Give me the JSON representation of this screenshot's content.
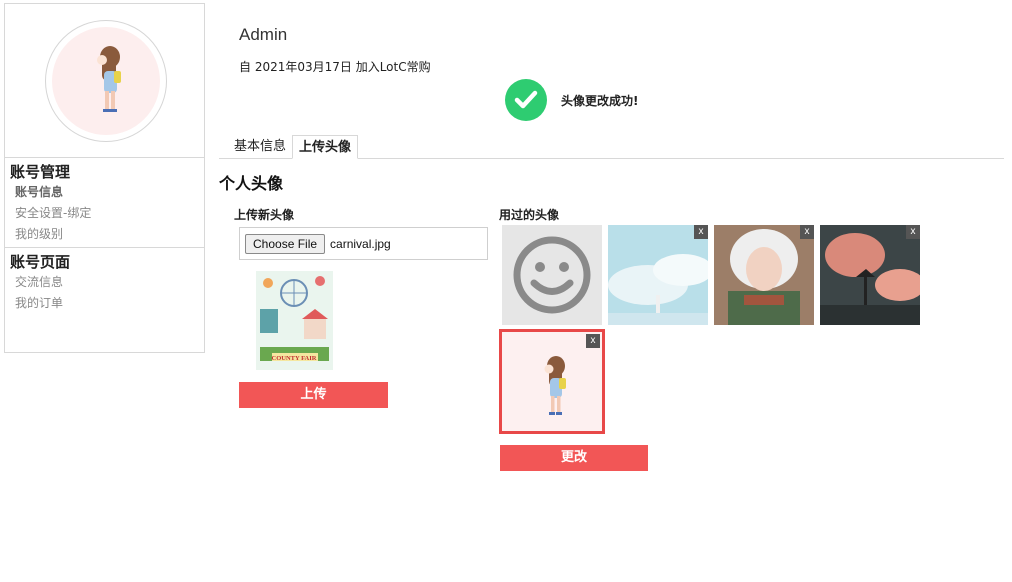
{
  "sidebar": {
    "sections": [
      {
        "title": "账号管理",
        "items": [
          "账号信息",
          "安全设置-绑定",
          "我的级别"
        ]
      },
      {
        "title": "账号页面",
        "items": [
          "交流信息",
          "我的订单"
        ]
      }
    ]
  },
  "header": {
    "username": "Admin",
    "joined": "自 2021年03月17日 加入LotC常购"
  },
  "notice": {
    "text": "头像更改成功!"
  },
  "tabs": [
    {
      "label": "基本信息"
    },
    {
      "label": "上传头像",
      "active": true
    }
  ],
  "section_title": "个人头像",
  "upload": {
    "title": "上传新头像",
    "file_button": "Choose File",
    "file_name": "carnival.jpg",
    "preview_text": "COUNTY FAIR",
    "button": "上传"
  },
  "used": {
    "title": "用过的头像",
    "close_label": "x",
    "button": "更改"
  },
  "colors": {
    "accent": "#f25656",
    "success": "#2ecc71",
    "selected_border": "#e84848"
  }
}
